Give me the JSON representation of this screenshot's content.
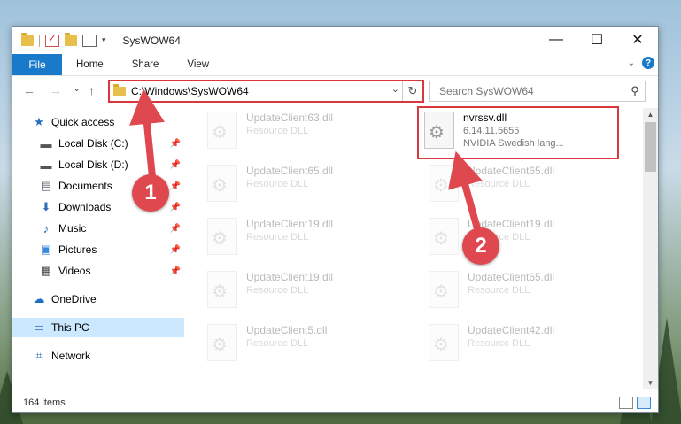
{
  "window": {
    "title": "SysWOW64",
    "caption": {
      "minimize": "—",
      "maximize": "☐",
      "close": "✕"
    }
  },
  "ribbon": {
    "file_tab": "File",
    "tabs": [
      "Home",
      "Share",
      "View"
    ],
    "help_label": "?"
  },
  "navigation": {
    "back": "←",
    "forward": "→",
    "recent": "⌄",
    "up": "↑",
    "address_path": "C:\\Windows\\SysWOW64",
    "search_placeholder": "Search SysWOW64"
  },
  "sidebar": {
    "items": [
      {
        "label": "Quick access",
        "icon": "star-icon",
        "pinned": false
      },
      {
        "label": "Local Disk (C:)",
        "icon": "drive-icon",
        "pinned": true
      },
      {
        "label": "Local Disk (D:)",
        "icon": "drive-icon",
        "pinned": true
      },
      {
        "label": "Documents",
        "icon": "documents-icon",
        "pinned": true
      },
      {
        "label": "Downloads",
        "icon": "download-icon",
        "pinned": true
      },
      {
        "label": "Music",
        "icon": "music-icon",
        "pinned": true
      },
      {
        "label": "Pictures",
        "icon": "pictures-icon",
        "pinned": true
      },
      {
        "label": "Videos",
        "icon": "videos-icon",
        "pinned": true
      },
      {
        "label": "OneDrive",
        "icon": "cloud-icon",
        "pinned": false
      },
      {
        "label": "This PC",
        "icon": "computer-icon",
        "pinned": false,
        "selected": true
      },
      {
        "label": "Network",
        "icon": "network-icon",
        "pinned": false
      }
    ]
  },
  "files": {
    "left": [
      {
        "name": "UpdateClient63.dll",
        "type": "Resource DLL"
      },
      {
        "name": "UpdateClient65.dll",
        "type": "Resource DLL"
      },
      {
        "name": "UpdateClient19.dll",
        "type": "Resource DLL"
      },
      {
        "name": "UpdateClient19.dll",
        "type": "Resource DLL"
      },
      {
        "name": "UpdateClient5.dll",
        "type": "Resource DLL"
      }
    ],
    "right": [
      {
        "name": "nvrssv.dll",
        "version": "6.14.11.5655",
        "desc": "NVIDIA Swedish lang...",
        "highlighted": true
      },
      {
        "name": "UpdateClient65.dll",
        "type": "Resource DLL"
      },
      {
        "name": "UpdateClient19.dll",
        "type": "Resource DLL"
      },
      {
        "name": "UpdateClient65.dll",
        "type": "Resource DLL"
      },
      {
        "name": "UpdateClient42.dll",
        "type": "Resource DLL"
      }
    ]
  },
  "status": {
    "item_count": "164 items"
  },
  "annotations": {
    "step1": "1",
    "step2": "2"
  },
  "colors": {
    "accent": "#1979ca",
    "highlight": "#d9373c",
    "selected_bg": "#cce8ff"
  }
}
